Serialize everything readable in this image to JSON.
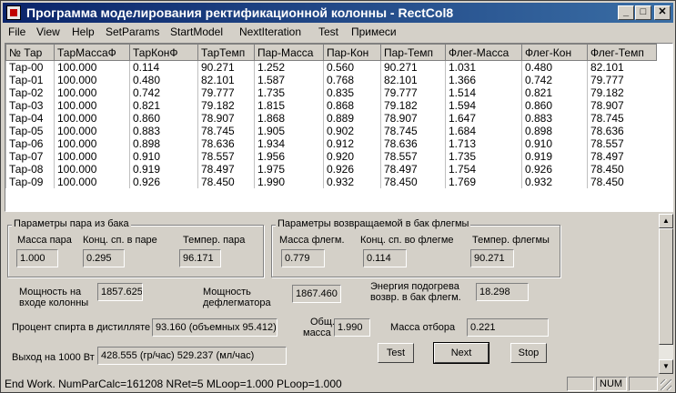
{
  "window": {
    "title": "Программа моделирования ректификационной колонны - RectCol8",
    "controls": {
      "minimize": "_",
      "maximize": "□",
      "close": "✕"
    }
  },
  "menu": [
    "File",
    "View",
    "Help",
    "SetParams",
    "StartModel",
    "NextIteration",
    "Test",
    "Примеси"
  ],
  "table": {
    "headers": [
      "№ Тар",
      "ТарМассаФ",
      "ТарКонФ",
      "ТарТемп",
      "Пар-Масса",
      "Пар-Кон",
      "Пар-Темп",
      "Флег-Масса",
      "Флег-Кон",
      "Флег-Темп"
    ],
    "rows": [
      [
        "Тар-00",
        "100.000",
        "0.114",
        "90.271",
        "1.252",
        "0.560",
        "90.271",
        "1.031",
        "0.480",
        "82.101"
      ],
      [
        "Тар-01",
        "100.000",
        "0.480",
        "82.101",
        "1.587",
        "0.768",
        "82.101",
        "1.366",
        "0.742",
        "79.777"
      ],
      [
        "Тар-02",
        "100.000",
        "0.742",
        "79.777",
        "1.735",
        "0.835",
        "79.777",
        "1.514",
        "0.821",
        "79.182"
      ],
      [
        "Тар-03",
        "100.000",
        "0.821",
        "79.182",
        "1.815",
        "0.868",
        "79.182",
        "1.594",
        "0.860",
        "78.907"
      ],
      [
        "Тар-04",
        "100.000",
        "0.860",
        "78.907",
        "1.868",
        "0.889",
        "78.907",
        "1.647",
        "0.883",
        "78.745"
      ],
      [
        "Тар-05",
        "100.000",
        "0.883",
        "78.745",
        "1.905",
        "0.902",
        "78.745",
        "1.684",
        "0.898",
        "78.636"
      ],
      [
        "Тар-06",
        "100.000",
        "0.898",
        "78.636",
        "1.934",
        "0.912",
        "78.636",
        "1.713",
        "0.910",
        "78.557"
      ],
      [
        "Тар-07",
        "100.000",
        "0.910",
        "78.557",
        "1.956",
        "0.920",
        "78.557",
        "1.735",
        "0.919",
        "78.497"
      ],
      [
        "Тар-08",
        "100.000",
        "0.919",
        "78.497",
        "1.975",
        "0.926",
        "78.497",
        "1.754",
        "0.926",
        "78.450"
      ],
      [
        "Тар-09",
        "100.000",
        "0.926",
        "78.450",
        "1.990",
        "0.932",
        "78.450",
        "1.769",
        "0.932",
        "78.450"
      ]
    ]
  },
  "steam_group": {
    "title": "Параметры пара из бака",
    "mass_label": "Масса пара",
    "mass_value": "1.000",
    "conc_label": "Конц. сп. в паре",
    "conc_value": "0.295",
    "temp_label": "Темпер. пара",
    "temp_value": "96.171"
  },
  "reflux_group": {
    "title": "Параметры возвращаемой в бак флегмы",
    "mass_label": "Масса флегм.",
    "mass_value": "0.779",
    "conc_label": "Конц. сп. во флегме",
    "conc_value": "0.114",
    "temp_label": "Темпер. флегмы",
    "temp_value": "90.271"
  },
  "power_input": {
    "label_line1": "Мощность на",
    "label_line2": "входе колонны",
    "value": "1857.625"
  },
  "power_dephleg": {
    "label_line1": "Мощность",
    "label_line2": "дефлегматора",
    "value": "1867.460"
  },
  "heat_energy": {
    "label_line1": "Энергия подогрева",
    "label_line2": "возвр. в бак флегм.",
    "value": "18.298"
  },
  "alcohol_percent": {
    "label": "Процент спирта в дистилляте",
    "value": "93.160 (объемных 95.412)"
  },
  "total_mass": {
    "label_line1": "Общ.",
    "label_line2": "масса",
    "value": "1.990"
  },
  "offtake_mass": {
    "label": "Масса отбора",
    "value": "0.221"
  },
  "output_per_1000w": {
    "label": "Выход на 1000 Вт",
    "value": "428.555 (гр/час)   529.237 (мл/час)"
  },
  "buttons": {
    "test": "Test",
    "next": "Next",
    "stop": "Stop"
  },
  "statusbar": {
    "text": "End Work. NumParCalc=161208 NRet=5 MLoop=1.000 PLoop=1.000",
    "num": "NUM"
  }
}
